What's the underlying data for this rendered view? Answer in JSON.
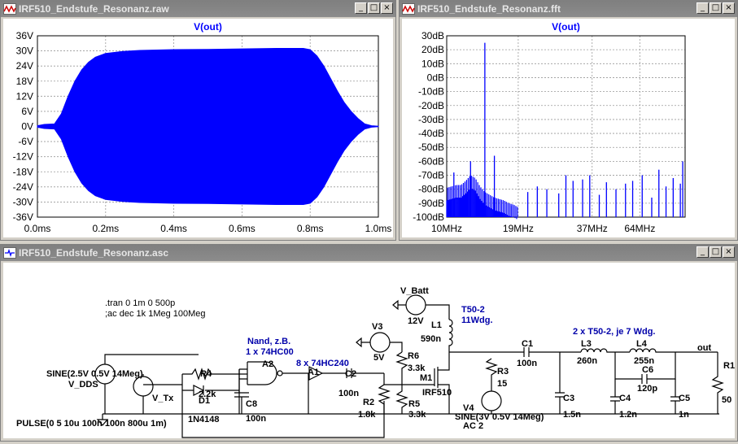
{
  "raw_window": {
    "title": "IRF510_Endstufe_Resonanz.raw",
    "trace": "V(out)"
  },
  "fft_window": {
    "title": "IRF510_Endstufe_Resonanz.fft",
    "trace": "V(out)"
  },
  "asc_window": {
    "title": "IRF510_Endstufe_Resonanz.asc"
  },
  "window_controls": {
    "minimize": "_",
    "maximize": "□",
    "close": "×"
  },
  "chart_data": [
    {
      "type": "area",
      "title": "V(out)",
      "color": "#0000ff",
      "x_unit": "ms",
      "x_ticks": [
        "0.0ms",
        "0.2ms",
        "0.4ms",
        "0.6ms",
        "0.8ms",
        "1.0ms"
      ],
      "y_ticks": [
        "36V",
        "30V",
        "24V",
        "18V",
        "12V",
        "6V",
        "0V",
        "-6V",
        "-12V",
        "-18V",
        "-24V",
        "-30V",
        "-36V"
      ],
      "xlim": [
        0,
        1.0
      ],
      "ylim": [
        -36,
        36
      ],
      "grid": true,
      "envelope": {
        "t": [
          0.0,
          0.02,
          0.05,
          0.07,
          0.09,
          0.11,
          0.13,
          0.15,
          0.17,
          0.2,
          0.25,
          0.3,
          0.4,
          0.5,
          0.6,
          0.7,
          0.78,
          0.8,
          0.82,
          0.84,
          0.86,
          0.88,
          0.9,
          0.92,
          0.94,
          0.96,
          0.98,
          1.0
        ],
        "amp": [
          0.3,
          0.8,
          1.0,
          5.0,
          12.0,
          18.0,
          22.5,
          25.5,
          27.5,
          29.0,
          29.8,
          30.2,
          30.5,
          30.6,
          30.8,
          31.0,
          31.0,
          30.5,
          28.0,
          24.0,
          19.0,
          14.0,
          9.5,
          6.0,
          3.2,
          1.0,
          0.3,
          0.1
        ]
      }
    },
    {
      "type": "line",
      "title": "V(out)",
      "color": "#0000ff",
      "x_ticks": [
        "10MHz",
        "19MHz",
        "37MHz",
        "64MHz"
      ],
      "y_ticks": [
        "30dB",
        "20dB",
        "10dB",
        "0dB",
        "-10dB",
        "-20dB",
        "-30dB",
        "-40dB",
        "-50dB",
        "-60dB",
        "-70dB",
        "-80dB",
        "-90dB",
        "-100dB"
      ],
      "ylim": [
        -100,
        30
      ],
      "grid": true,
      "noise_floor": {
        "x_frac": [
          0.0,
          0.02,
          0.04,
          0.06,
          0.08,
          0.1,
          0.12,
          0.14,
          0.16,
          0.18,
          0.2,
          0.22,
          0.24,
          0.26,
          0.28,
          0.3
        ],
        "db": [
          -85,
          -84,
          -83,
          -83,
          -80,
          -76,
          -78,
          -84,
          -88,
          -90,
          -92,
          -93,
          -94,
          -96,
          -97,
          -99
        ]
      },
      "peaks": [
        {
          "x_frac": 0.16,
          "db": 25
        },
        {
          "x_frac": 0.03,
          "db": -68
        },
        {
          "x_frac": 0.1,
          "db": -60
        },
        {
          "x_frac": 0.2,
          "db": -56
        },
        {
          "x_frac": 0.27,
          "db": -92
        },
        {
          "x_frac": 0.34,
          "db": -82
        },
        {
          "x_frac": 0.38,
          "db": -78
        },
        {
          "x_frac": 0.42,
          "db": -80
        },
        {
          "x_frac": 0.47,
          "db": -83
        },
        {
          "x_frac": 0.5,
          "db": -70
        },
        {
          "x_frac": 0.53,
          "db": -74
        },
        {
          "x_frac": 0.57,
          "db": -73
        },
        {
          "x_frac": 0.6,
          "db": -70
        },
        {
          "x_frac": 0.64,
          "db": -84
        },
        {
          "x_frac": 0.67,
          "db": -75
        },
        {
          "x_frac": 0.71,
          "db": -80
        },
        {
          "x_frac": 0.75,
          "db": -76
        },
        {
          "x_frac": 0.78,
          "db": -74
        },
        {
          "x_frac": 0.82,
          "db": -70
        },
        {
          "x_frac": 0.86,
          "db": -86
        },
        {
          "x_frac": 0.89,
          "db": -66
        },
        {
          "x_frac": 0.92,
          "db": -78
        },
        {
          "x_frac": 0.95,
          "db": -72
        },
        {
          "x_frac": 0.98,
          "db": -76
        },
        {
          "x_frac": 0.99,
          "db": -60
        }
      ]
    }
  ],
  "schematic": {
    "directives": [
      ".tran 0 1m 0 500p",
      ";ac dec 1k 1Meg 100Meg"
    ],
    "labels": {
      "vdds_spec": "SINE(2.5V 0.5V 14Meg)",
      "vdds": "V_DDS",
      "vtx": "V_Tx",
      "pulse": "PULSE(0 5 10u 100n 100n 800u 1m)",
      "r4": "R4",
      "r4v": "2.2k",
      "d1": "D1",
      "d1v": "1N4148",
      "c8": "C8",
      "c8v": "100n",
      "nand_title": "Nand, z.B.",
      "nand_part": "1 x 74HC00",
      "a2": "A2",
      "buf_part": "8 x 74HC240",
      "a1": "A1",
      "c2": "C2",
      "c2v": "100n",
      "r2": "R2",
      "r2v": "1.8k",
      "v3": "V3",
      "v3v": "5V",
      "r6": "R6",
      "r6v": "3.3k",
      "r5": "R5",
      "r5v": "3.3k",
      "vbatt": "V_Batt",
      "vbattv": "12V",
      "l1": "L1",
      "l1v": "590n",
      "l1core": "T50-2",
      "l1wdg": "11Wdg.",
      "m1": "M1",
      "m1v": "IRF510",
      "r3": "R3",
      "r3v": "15",
      "v4": "V4",
      "v4spec": "SINE(3V 0.5V 14Meg)",
      "v4ac": "AC 2",
      "c1": "C1",
      "c1v": "100n",
      "c3": "C3",
      "c3v": "1.5n",
      "l3": "L3",
      "l3v": "260n",
      "l4": "L4",
      "l4v": "255n",
      "l34core": "2 x T50-2, je 7 Wdg.",
      "c6": "C6",
      "c6v": "120p",
      "c4": "C4",
      "c4v": "1.2n",
      "c5": "C5",
      "c5v": "1n",
      "out": "out",
      "r1": "R1",
      "r1v": "50"
    }
  }
}
